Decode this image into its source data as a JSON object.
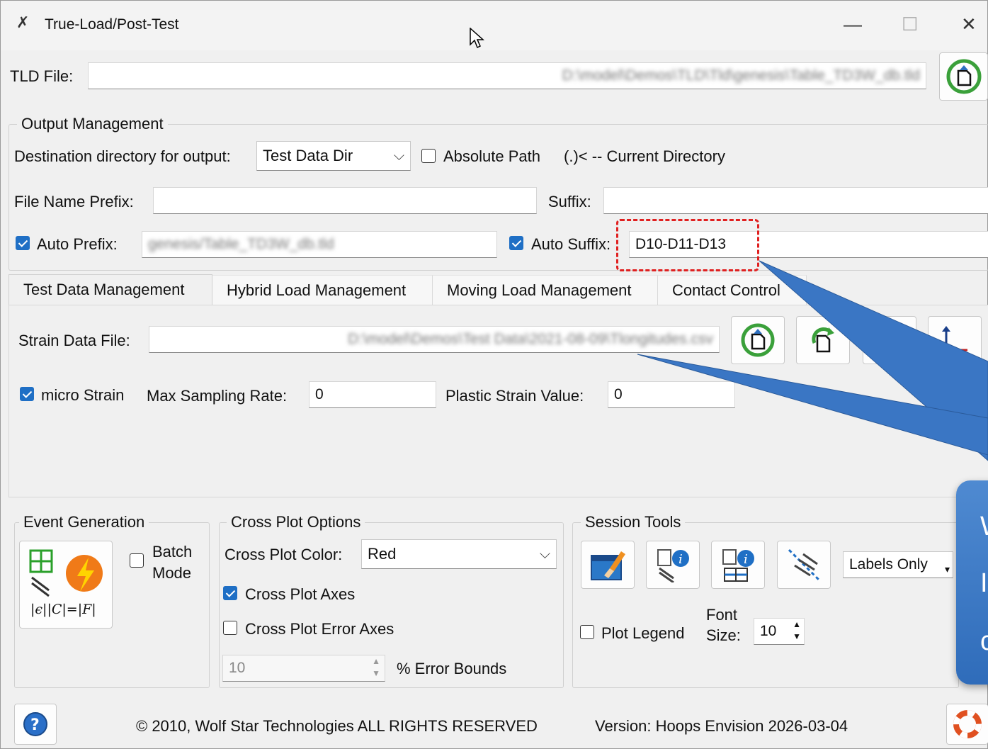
{
  "window": {
    "title": "True-Load/Post-Test",
    "controls": [
      "—",
      "☐",
      "✕"
    ]
  },
  "tld_file": {
    "label": "TLD File:",
    "value": "D:\\model\\Demos\\TLD\\Tld\\genesis\\Table_TD3W_db.tld"
  },
  "output_management": {
    "title": "Output Management",
    "destination_label": "Destination directory for output:",
    "destination_value": "Test Data Dir",
    "absolute_path_label": "Absolute Path",
    "absolute_path_checked": false,
    "current_dir_note": "(.)< -- Current Directory",
    "file_prefix_label": "File Name Prefix:",
    "file_prefix_value": "",
    "suffix_label": "Suffix:",
    "suffix_value": "",
    "auto_prefix_label": "Auto Prefix:",
    "auto_prefix_checked": true,
    "auto_prefix_value": "genesis/Table_TD3W_db.tld",
    "auto_suffix_label": "Auto Suffix:",
    "auto_suffix_checked": true,
    "auto_suffix_value": "D10-D11-D13"
  },
  "tabs": [
    {
      "label": "Test Data Management",
      "active": true
    },
    {
      "label": "Hybrid Load Management",
      "active": false
    },
    {
      "label": "Moving Load Management",
      "active": false
    },
    {
      "label": "Contact Control",
      "active": false
    }
  ],
  "test_data": {
    "strain_file_label": "Strain Data File:",
    "strain_file_value": "D:\\model\\Demos\\Test Data\\2021-08-09\\Tlongitudes.csv",
    "micro_strain_label": "micro Strain",
    "micro_strain_checked": true,
    "max_rate_label": "Max Sampling Rate:",
    "max_rate_value": "0",
    "plastic_label": "Plastic Strain Value:",
    "plastic_value": "0"
  },
  "event_generation": {
    "title": "Event Generation",
    "batch_label_1": "Batch",
    "batch_label_2": "Mode",
    "batch_checked": false,
    "formula": "|ϵ||C|=|F|"
  },
  "cross_plot": {
    "title": "Cross Plot Options",
    "color_label": "Cross Plot Color:",
    "color_value": "Red",
    "axes_label": "Cross Plot Axes",
    "axes_checked": true,
    "error_axes_label": "Cross Plot Error Axes",
    "error_axes_checked": false,
    "error_value": "10",
    "error_bounds_label": "% Error Bounds"
  },
  "session_tools": {
    "title": "Session Tools",
    "labels_dropdown": "Labels Only",
    "plot_legend_label": "Plot Legend",
    "plot_legend_checked": false,
    "font_label_1": "Font",
    "font_label_2": "Size:",
    "font_size_value": "10"
  },
  "callout": {
    "letters": [
      "W",
      "I",
      "c"
    ]
  },
  "footer": {
    "copyright": "© 2010, Wolf Star Technologies  ALL RIGHTS RESERVED",
    "version": "Version:  Hoops Envision 2026-03-04"
  },
  "colors": {
    "accent": "#1f6fc5",
    "highlight_dash": "#e02020",
    "callout": "#3a76c4"
  }
}
